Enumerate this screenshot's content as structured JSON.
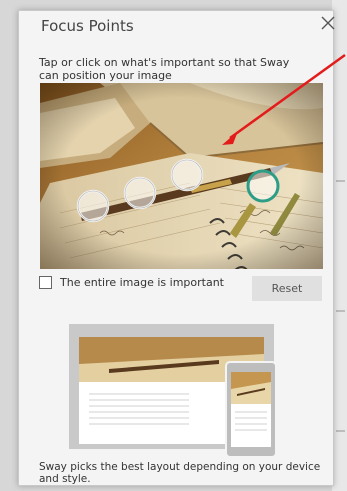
{
  "panel": {
    "title": "Focus Points",
    "instructions": "Tap or click on what's important so that Sway can position your image",
    "checkbox_label": "The entire image is important",
    "reset_label": "Reset",
    "caption": "Sway picks the best layout depending on your device and style."
  },
  "focus_points": {
    "count": 4
  },
  "icons": {
    "close": "close-icon",
    "focus_point": "focus-point-icon"
  },
  "colors": {
    "panel_bg": "#f4f4f4",
    "selected_focus_ring": "#2e9d87",
    "annotation_arrow": "#e41b1b"
  }
}
